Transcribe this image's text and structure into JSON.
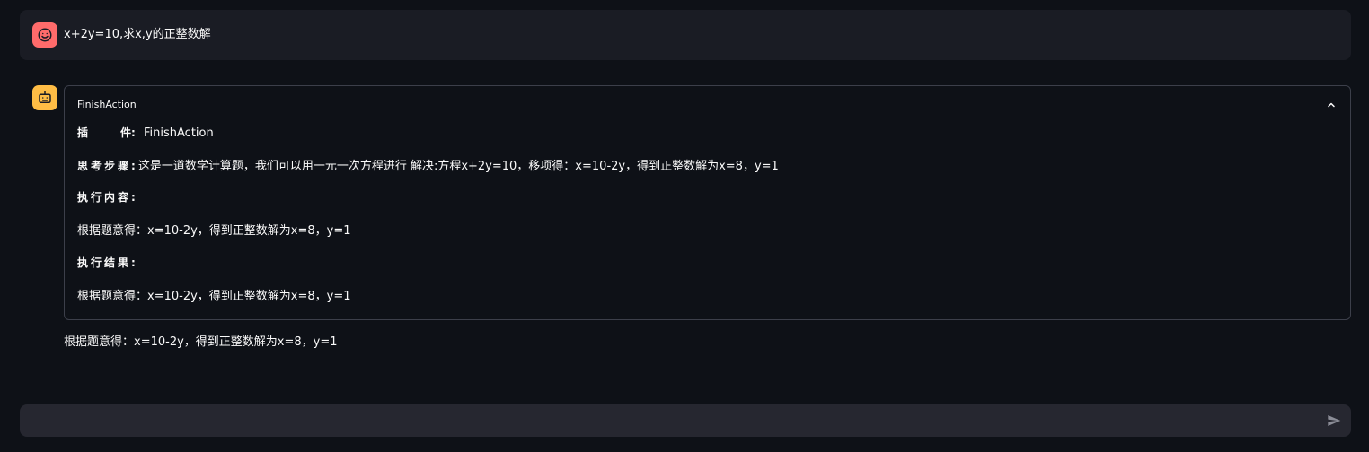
{
  "user_message": {
    "avatar_icon": "smiling-face-icon",
    "avatar_color": "#ff6b6b",
    "text": "x+2y=10,求x,y的正整数解"
  },
  "assistant_message": {
    "avatar_icon": "robot-icon",
    "avatar_color": "#ffbd45",
    "expander": {
      "title": "FinishAction",
      "toggle_icon": "chevron-up-icon",
      "plugin_label_1": "插",
      "plugin_label_2": "件:",
      "plugin_value": "FinishAction",
      "thought_label": "思考步骤:",
      "thought_value": "这是一道数学计算题，我们可以用一元一次方程进行 解决:方程x+2y=10，移项得：x=10-2y，得到正整数解为x=8，y=1",
      "exec_content_label": "执行内容:",
      "exec_content_value": "根据题意得：x=10-2y，得到正整数解为x=8，y=1",
      "exec_result_label": "执行结果:",
      "exec_result_value": "根据题意得：x=10-2y，得到正整数解为x=8，y=1"
    },
    "final_answer": "根据题意得：x=10-2y，得到正整数解为x=8，y=1"
  },
  "chat_input": {
    "value": "",
    "placeholder": "",
    "send_icon": "send-icon"
  }
}
